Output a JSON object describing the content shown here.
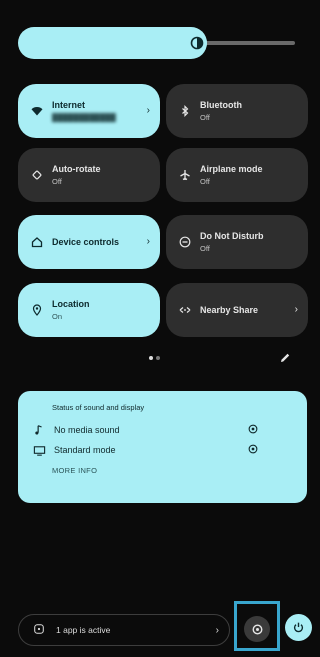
{
  "tiles": [
    {
      "title": "Internet",
      "subtitle": "",
      "state": "on",
      "chevron": "›",
      "icon": "wifi-icon"
    },
    {
      "title": "Bluetooth",
      "subtitle": "Off",
      "state": "off",
      "icon": "bluetooth-icon"
    },
    {
      "title": "Auto-rotate",
      "subtitle": "Off",
      "state": "off",
      "icon": "rotate-icon"
    },
    {
      "title": "Airplane mode",
      "subtitle": "Off",
      "state": "off",
      "icon": "airplane-icon"
    },
    {
      "title": "Device controls",
      "subtitle": "",
      "state": "on",
      "chevron": "›",
      "icon": "home-icon"
    },
    {
      "title": "Do Not Disturb",
      "subtitle": "Off",
      "state": "off",
      "icon": "dnd-icon"
    },
    {
      "title": "Location",
      "subtitle": "On",
      "state": "on",
      "icon": "location-icon"
    },
    {
      "title": "Nearby Share",
      "subtitle": "",
      "state": "off",
      "chevron": "›",
      "icon": "nearby-share-icon"
    }
  ],
  "sound_card": {
    "heading": "Status of sound and display",
    "rows": [
      {
        "label": "No media sound",
        "icon": "music-note-icon"
      },
      {
        "label": "Standard mode",
        "icon": "display-icon"
      }
    ],
    "more_info": "MORE INFO"
  },
  "footer": {
    "apps_active": "1 app is active",
    "chevron": "›"
  },
  "colors": {
    "accent": "#a9eef5",
    "tile_off": "#2e2e2e",
    "background": "#0b0b0b",
    "highlight": "#39a6ce"
  }
}
